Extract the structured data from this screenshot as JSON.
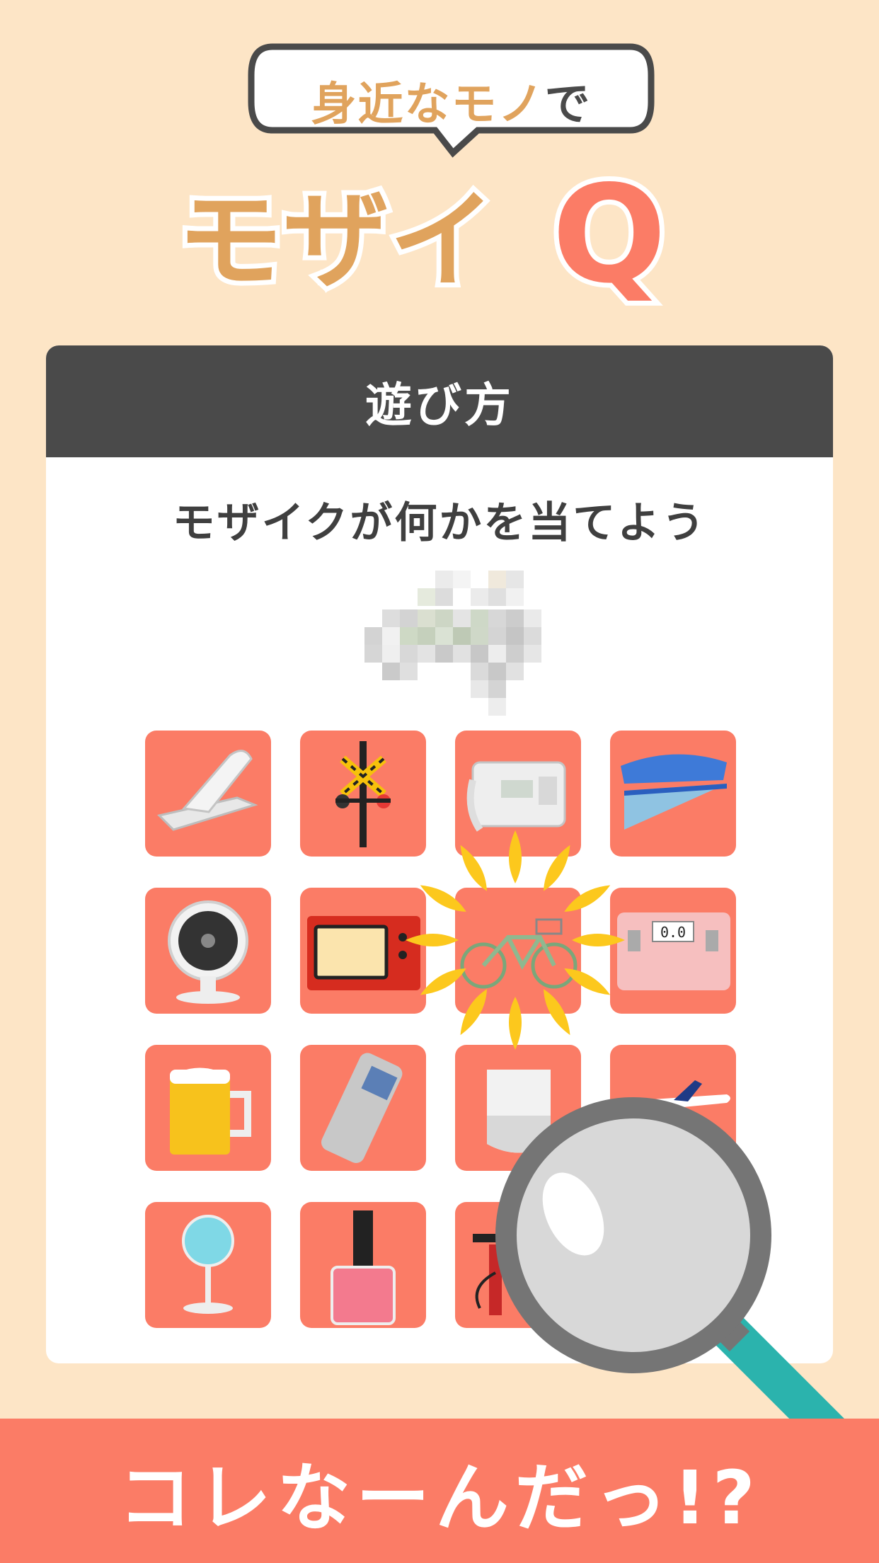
{
  "header": {
    "bubble_part1": "身近な",
    "bubble_part2": "モノ",
    "bubble_part3": "で",
    "logo_part1": "モザイ",
    "logo_part2": "Q"
  },
  "card": {
    "title": "遊び方",
    "subtitle": "モザイクが何かを当てよう"
  },
  "tiles": [
    "nail-clipper-icon",
    "railroad-crossing-icon",
    "telephone-icon",
    "stapler-icon",
    "circulator-fan-icon",
    "microwave-icon",
    "bicycle-icon",
    "scale-icon",
    "beer-mug-icon",
    "voice-recorder-icon",
    "smart-speaker-icon",
    "airplane-icon",
    "electric-fan-icon",
    "nail-polish-icon",
    "bike-pump-icon",
    ""
  ],
  "scale_display": "0.0",
  "footer": {
    "text": "コレなーんだっ!?"
  },
  "colors": {
    "background": "#fde5c6",
    "accent": "#fb7c66",
    "header_dark": "#4a4a4a",
    "logo_orange": "#e0a35d",
    "burst": "#fcc81d",
    "loupe_handle": "#2bb3ad"
  }
}
